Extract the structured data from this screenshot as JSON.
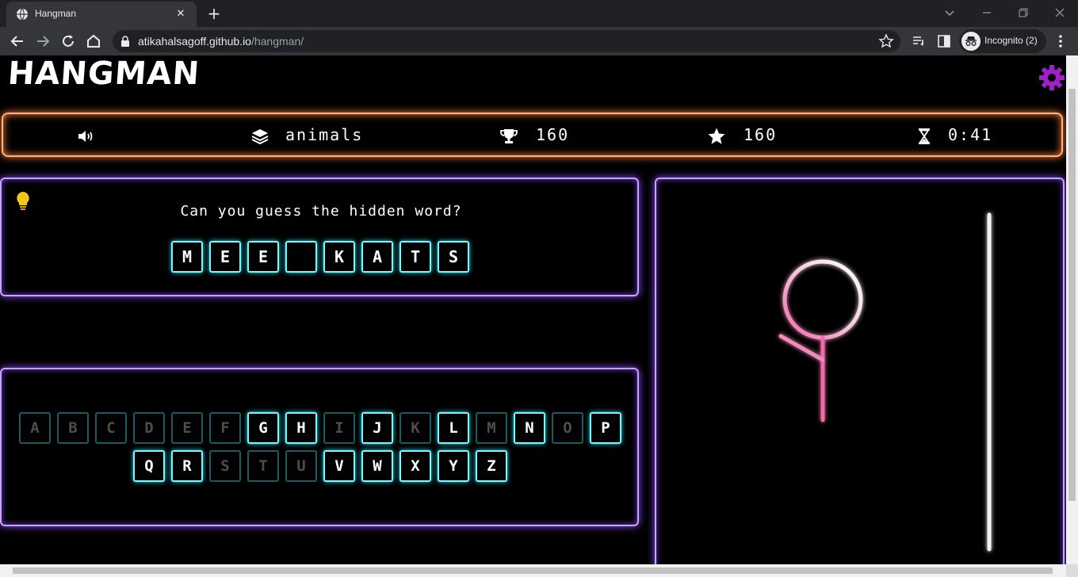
{
  "browser": {
    "tab_title": "Hangman",
    "url_host": "atikahalsagoff.github.io",
    "url_path": "/hangman/",
    "profile_label": "Incognito (2)"
  },
  "game": {
    "title": "HANGMAN",
    "category": "animals",
    "high_score": "160",
    "score": "160",
    "timer": "0:41",
    "prompt": "Can you guess the hidden word?",
    "word_slots": [
      "M",
      "E",
      "E",
      "",
      "K",
      "A",
      "T",
      "S"
    ],
    "keyboard_row1": [
      {
        "letter": "A",
        "used": true
      },
      {
        "letter": "B",
        "used": true
      },
      {
        "letter": "C",
        "used": true
      },
      {
        "letter": "D",
        "used": true
      },
      {
        "letter": "E",
        "used": true
      },
      {
        "letter": "F",
        "used": true
      },
      {
        "letter": "G",
        "used": false
      },
      {
        "letter": "H",
        "used": false
      },
      {
        "letter": "I",
        "used": true
      },
      {
        "letter": "J",
        "used": false
      },
      {
        "letter": "K",
        "used": true
      },
      {
        "letter": "L",
        "used": false
      },
      {
        "letter": "M",
        "used": true
      },
      {
        "letter": "N",
        "used": false
      },
      {
        "letter": "O",
        "used": true
      },
      {
        "letter": "P",
        "used": false
      }
    ],
    "keyboard_row2": [
      {
        "letter": "Q",
        "used": false
      },
      {
        "letter": "R",
        "used": false
      },
      {
        "letter": "S",
        "used": true
      },
      {
        "letter": "T",
        "used": true
      },
      {
        "letter": "U",
        "used": true
      },
      {
        "letter": "V",
        "used": false
      },
      {
        "letter": "W",
        "used": false
      },
      {
        "letter": "X",
        "used": false
      },
      {
        "letter": "Y",
        "used": false
      },
      {
        "letter": "Z",
        "used": false
      }
    ],
    "wrong_guess_parts_shown": [
      "head",
      "body",
      "left-arm"
    ]
  },
  "colors": {
    "status_glow": "#ff7f3f",
    "panel_glow": "#c9a3f5",
    "key_glow": "#7ff6ff",
    "gear": "#a020c8",
    "bulb": "#f5c518",
    "hangman_pink": "#f06aa8"
  }
}
